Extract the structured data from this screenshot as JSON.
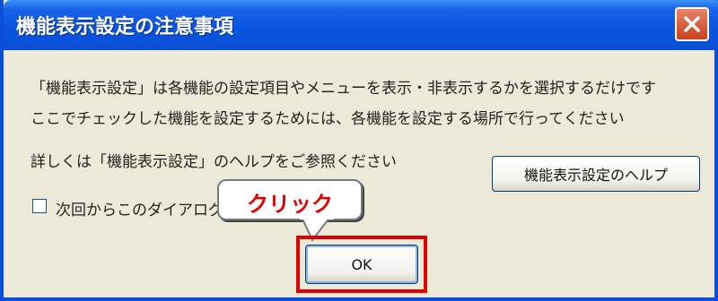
{
  "dialog": {
    "title": "機能表示設定の注意事項",
    "close_icon": "close-icon"
  },
  "message": {
    "line1": "「機能表示設定」は各機能の設定項目やメニューを表示・非表示するかを選択するだけです",
    "line2": "ここでチェックした機能を設定するためには、各機能を設定する場所で行ってください",
    "line3": "詳しくは「機能表示設定」のヘルプをご参照ください"
  },
  "buttons": {
    "help_label": "機能表示設定のヘルプ",
    "ok_label": "OK"
  },
  "checkbox": {
    "label": "次回からこのダイアログ",
    "checked": false
  },
  "annotation": {
    "callout_text": "クリック",
    "highlight_color": "#e00000"
  },
  "colors": {
    "titlebar": "#0a4fd6",
    "close_button": "#c9401e",
    "dialog_background": "#ece9d8"
  }
}
